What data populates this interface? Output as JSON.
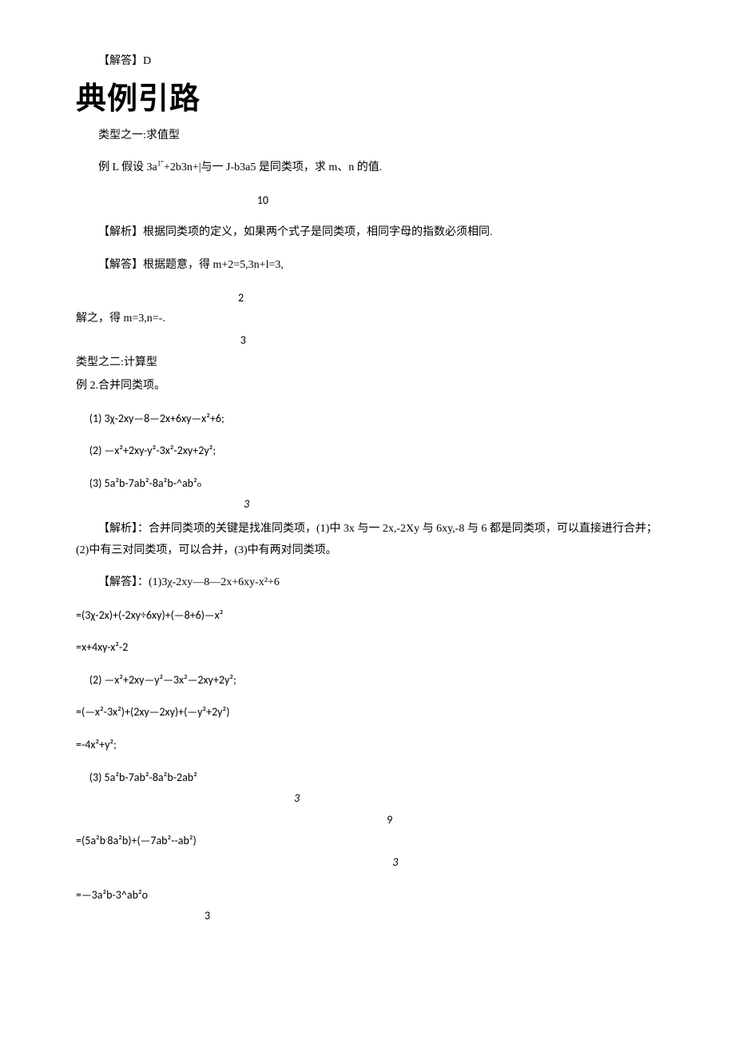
{
  "top": {
    "answer": "【解答】D"
  },
  "heading": "典例引路",
  "type1": {
    "title": "类型之一:求值型",
    "example_label": "例 L 假设 3a",
    "example_sup1": "1\"",
    "example_mid1": "+2b3n+|与一 J-b3a5 是同类项，求 m、n 的值.",
    "frac_after_example": "10",
    "analysis": "【解析】根据同类项的定义，如果两个式子是同类项，相同字母的指数必须相同.",
    "answer": "【解答】根据题意，得 m+2=5,3n+l=3,",
    "frac_num": "2",
    "solve_line": "解之，得 m=3,n=-.",
    "frac_den": "3"
  },
  "type2": {
    "title": "类型之二:计算型",
    "example_label": "例 2.合并同类项。",
    "item1": "(1)    3χ-2xy—8—2x+6xy—x²+6;",
    "item2": "(2)    —x²+2xy-y²-3x²-2xy+2y²;",
    "item3_a": "(3)    5a²b-7ab²-8a²b-^ab²",
    "item3_sub": "o",
    "item3_frac": "3",
    "analysis": "【解析】：合并同类项的关键是找准同类项，(1)中 3x 与一 2x,-2Xy 与 6xy,-8 与 6 都是同类项，可以直接进行合并；(2)中有三对同类项，可以合并，(3)中有两对同类项。",
    "answer_label": "【解答】：(1)3χ-2xy—8—2x+6xy-x²+6",
    "eq1": "=(3χ-2x)+(-2xy÷6xy)+(—8+6)—x²",
    "eq2": "=x+4xy-x²-2",
    "part2_label": "(2)    —x²+2xy—y²—3x²—2xy+2y²;",
    "eq3": "=(—x²-3x²)+(2xy—2xy)+(—y²+2y²)",
    "eq4": "=-4x²+y²;",
    "part3_label": "(3)    5a²b-7ab²-8a²b-2ab²",
    "part3_frac1": "3",
    "part3_frac2": "9",
    "eq5_a": "=(5a²b",
    "eq5_b": "8a²b)+(—7ab²--ab²)",
    "part3_frac3": "3",
    "eq6": "=—3a²b-3^ab²o",
    "part3_frac4": "3"
  }
}
